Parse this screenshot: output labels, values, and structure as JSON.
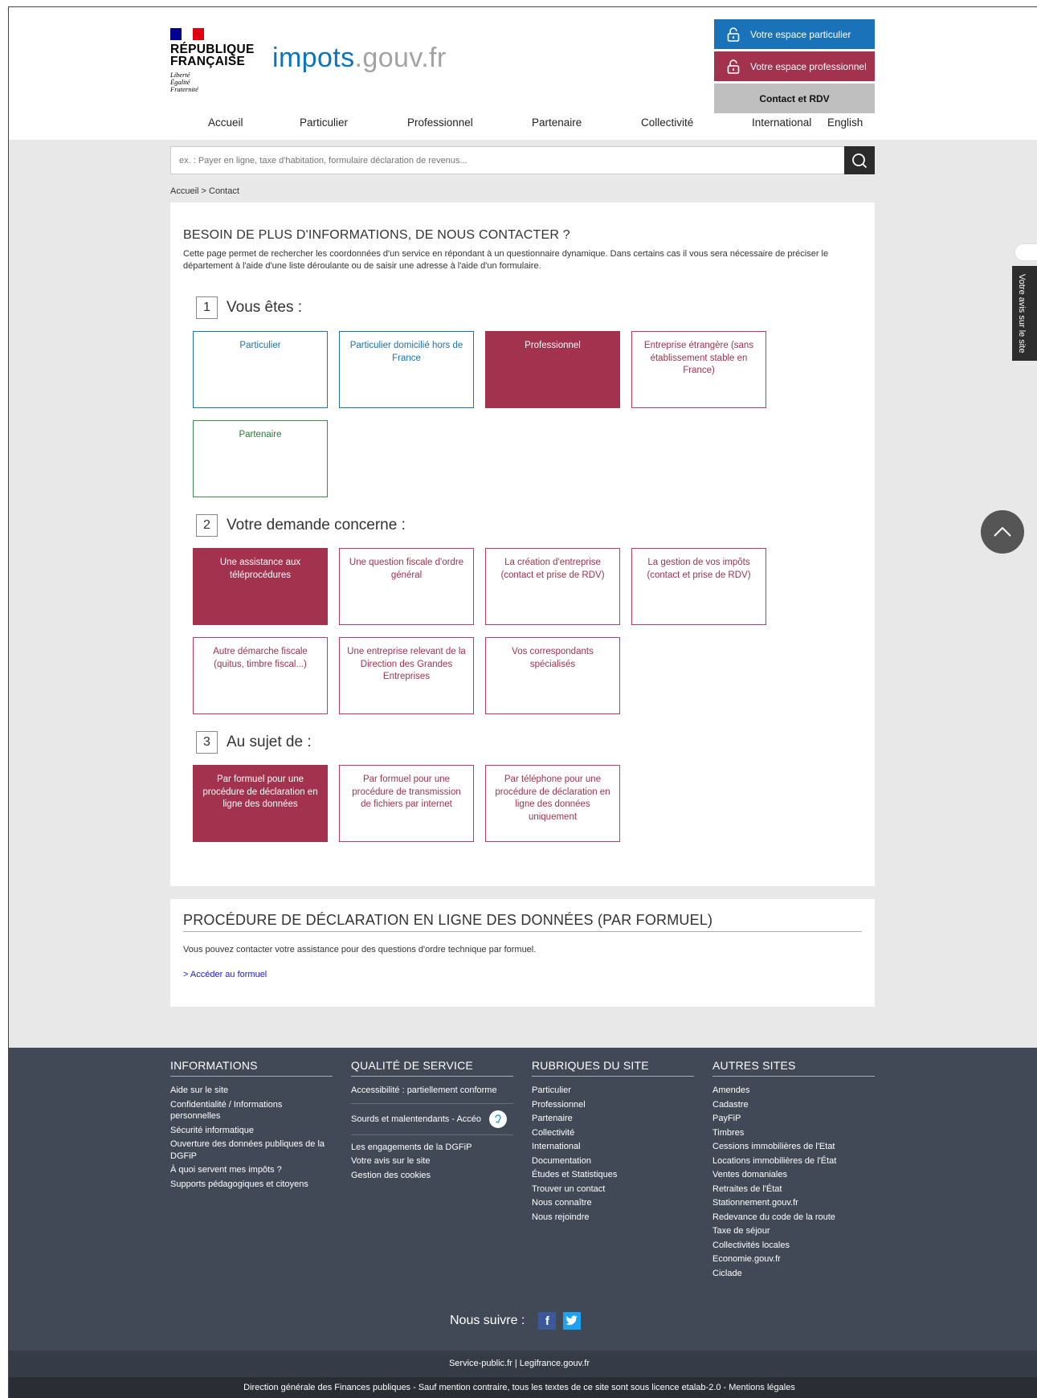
{
  "header": {
    "rf_line1": "RÉPUBLIQUE",
    "rf_line2": "FRANÇAISE",
    "rf_motto1": "Liberté",
    "rf_motto2": "Égalité",
    "rf_motto3": "Fraternité",
    "site_name_part1": "impots",
    "site_name_part2": ".gouv.fr",
    "btn_particulier": "Votre espace particulier",
    "btn_professionnel": "Votre espace professionnel",
    "btn_contact": "Contact et RDV",
    "colors": {
      "blue": "#1a73b8",
      "red": "#a3324e",
      "grey": "#bfbfbf"
    }
  },
  "nav": [
    "Accueil",
    "Particulier",
    "Professionnel",
    "Partenaire",
    "Collectivité",
    "International",
    "English"
  ],
  "search": {
    "placeholder": "ex. : Payer en ligne, taxe d'habitation, formulaire déclaration de revenus..."
  },
  "breadcrumb": "Accueil > Contact",
  "main": {
    "title": "BESOIN DE PLUS D'INFORMATIONS, DE NOUS CONTACTER ?",
    "intro": "Cette page permet de rechercher les coordonnées d'un service en répondant à un questionnaire dynamique. Dans certains cas il vous sera nécessaire de préciser le département à l'aide d'une liste déroulante ou de saisir une adresse à l'aide d'un formulaire.",
    "steps": [
      {
        "num": "1",
        "label": "Vous êtes :",
        "options": [
          {
            "label": "Particulier",
            "state": "blue"
          },
          {
            "label": "Particulier domicilié hors de France",
            "state": "blue"
          },
          {
            "label": "Professionnel",
            "state": "selected"
          },
          {
            "label": "Entreprise étrangère (sans établissement stable en France)",
            "state": "red"
          },
          {
            "label": "Partenaire",
            "state": "green"
          }
        ]
      },
      {
        "num": "2",
        "label": "Votre demande concerne :",
        "options": [
          {
            "label": "Une assistance aux téléprocédures",
            "state": "selected"
          },
          {
            "label": "Une question fiscale d'ordre général",
            "state": "red"
          },
          {
            "label": "La création d'entreprise (contact et prise de RDV)",
            "state": "red"
          },
          {
            "label": "La gestion de vos impôts (contact et prise de RDV)",
            "state": "red"
          },
          {
            "label": "Autre démarche fiscale (quitus, timbre fiscal...)",
            "state": "red"
          },
          {
            "label": "Une entreprise relevant de la Direction des Grandes Entreprises",
            "state": "red"
          },
          {
            "label": "Vos correspondants spécialisés",
            "state": "red"
          }
        ]
      },
      {
        "num": "3",
        "label": "Au sujet de :",
        "options": [
          {
            "label": "Par formuel pour une procédure de déclaration en ligne des données",
            "state": "selected"
          },
          {
            "label": "Par formuel pour une procédure de transmission de fichiers par internet",
            "state": "red"
          },
          {
            "label": "Par téléphone pour une procédure de déclaration en ligne des données uniquement",
            "state": "red"
          }
        ]
      }
    ]
  },
  "result": {
    "title": "PROCÉDURE DE DÉCLARATION EN LIGNE DES DONNÉES (PAR FORMUEL)",
    "text": "Vous pouvez contacter votre assistance pour des questions d'ordre technique par formuel.",
    "link": "> Accéder au formuel"
  },
  "side_tab": "Votre avis sur le site",
  "footer": {
    "columns": [
      {
        "title": "INFORMATIONS",
        "items": [
          "Aide sur le site",
          "Confidentialité / Informations personnelles",
          "Sécurité informatique",
          "Ouverture des données publiques de la DGFiP",
          "À quoi servent mes impôts ?",
          "Supports pédagogiques et citoyens"
        ]
      },
      {
        "title": "QUALITÉ DE SERVICE",
        "items": [
          "Accessibilité : partiellement conforme",
          "Sourds et malentendants - Accéo",
          "Les engagements de la DGFiP",
          "Votre avis sur le site",
          "Gestion des cookies"
        ]
      },
      {
        "title": "RUBRIQUES DU SITE",
        "items": [
          "Particulier",
          "Professionnel",
          "Partenaire",
          "Collectivité",
          "International",
          "Documentation",
          "Études et Statistiques",
          "Trouver un contact",
          "Nous connaître",
          "Nous rejoindre"
        ]
      },
      {
        "title": "AUTRES SITES",
        "items": [
          "Amendes",
          "Cadastre",
          "PayFiP",
          "Timbres",
          "Cessions immobilières de l'Etat",
          "Locations immobilières de l'État",
          "Ventes domaniales",
          "Retraites de l'État",
          "Stationnement.gouv.fr",
          "Redevance du code de la route",
          "Taxe de séjour",
          "Collectivités locales",
          "Economie.gouv.fr",
          "Ciclade"
        ]
      }
    ],
    "follow": "Nous suivre :",
    "links_line": "Service-public.fr | Legifrance.gouv.fr",
    "legal": "Direction générale des Finances publiques - Sauf mention contraire, tous les textes de ce site sont sous licence etalab-2.0 - Mentions légales"
  }
}
